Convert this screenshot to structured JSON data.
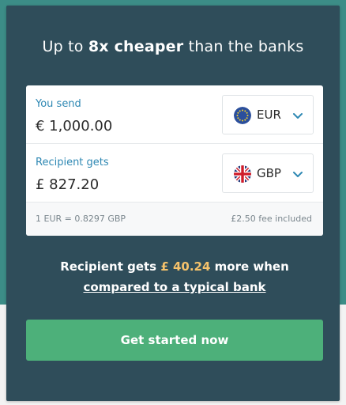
{
  "headline": {
    "prefix": "Up to",
    "emphasis": "8x cheaper",
    "suffix": "than the banks"
  },
  "send": {
    "label": "You send",
    "amount": "€ 1,000.00",
    "currency": "EUR",
    "flag_icon": "eu-flag-icon"
  },
  "receive": {
    "label": "Recipient gets",
    "amount": "£ 827.20",
    "currency": "GBP",
    "flag_icon": "uk-flag-icon"
  },
  "rate_text": "1 EUR = 0.8297 GBP",
  "fee_text": "£2.50 fee included",
  "savings": {
    "prefix": "Recipient gets",
    "amount": "£ 40.24",
    "middle": "more when",
    "link": "compared to a typical bank"
  },
  "cta_label": "Get started now",
  "colors": {
    "background_top": "#3c8d87",
    "panel": "#2f4d5a",
    "label_blue": "#2e88b3",
    "highlight": "#f5c26b",
    "cta": "#4db07a"
  }
}
